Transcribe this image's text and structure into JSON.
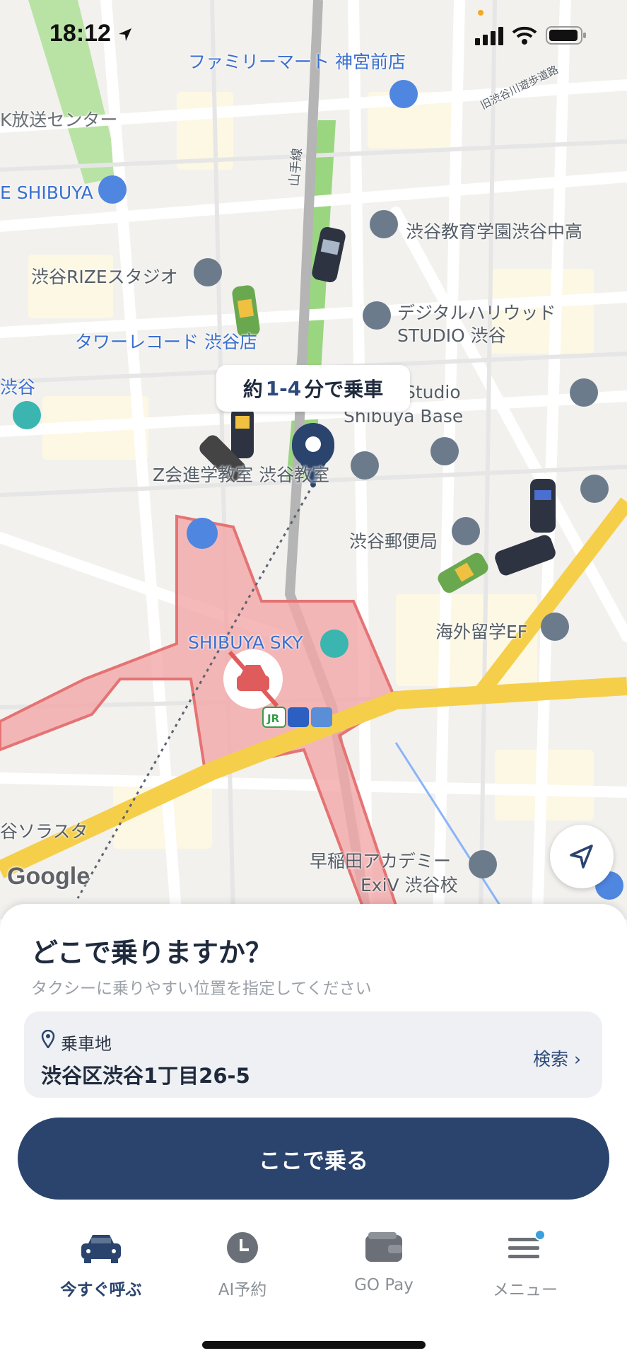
{
  "status": {
    "time": "18:12"
  },
  "map": {
    "labels": {
      "familymart": "ファミリーマート 神宮前店",
      "nhk": "K放送センター",
      "shibuya_e": "E SHIBUYA",
      "school1": "渋谷教育学園渋谷中高",
      "rize": "渋谷RIZEスタジオ",
      "digital1": "デジタルハリウッド",
      "digital2": "STUDIO 渋谷",
      "tower": "タワーレコード 渋谷店",
      "shibuya_left": "渋谷",
      "studio": "Studio",
      "shibuya_base": "Shibuya Base",
      "zkai": "Z会進学教室 渋谷教室",
      "post": "渋谷郵便局",
      "ef": "海外留学EF",
      "sky": "SHIBUYA SKY",
      "solasta": "谷ソラスタ",
      "waseda1": "早稲田アカデミー",
      "waseda2": "ExiV 渋谷校",
      "yamanote": "山手線",
      "old_river": "旧渋谷川遊歩道路"
    },
    "eta": {
      "prefix": "約",
      "range": "1-4",
      "suffix": "分で乗車"
    },
    "google": "Google"
  },
  "sheet": {
    "title": "どこで乗りますか？",
    "subtitle": "タクシーに乗りやすい位置を指定してください",
    "pickup_label": "乗車地",
    "pickup_address": "渋谷区渋谷1丁目26-5",
    "search_label": "検索 ›",
    "ride_button": "ここで乗る"
  },
  "tabs": [
    {
      "label": "今すぐ呼ぶ",
      "icon": "taxi-icon"
    },
    {
      "label": "AI予約",
      "icon": "clock-icon"
    },
    {
      "label": "GO Pay",
      "icon": "wallet-icon"
    },
    {
      "label": "メニュー",
      "icon": "menu-icon"
    }
  ],
  "colors": {
    "accent": "#2a446e",
    "restricted": "#e57373"
  }
}
